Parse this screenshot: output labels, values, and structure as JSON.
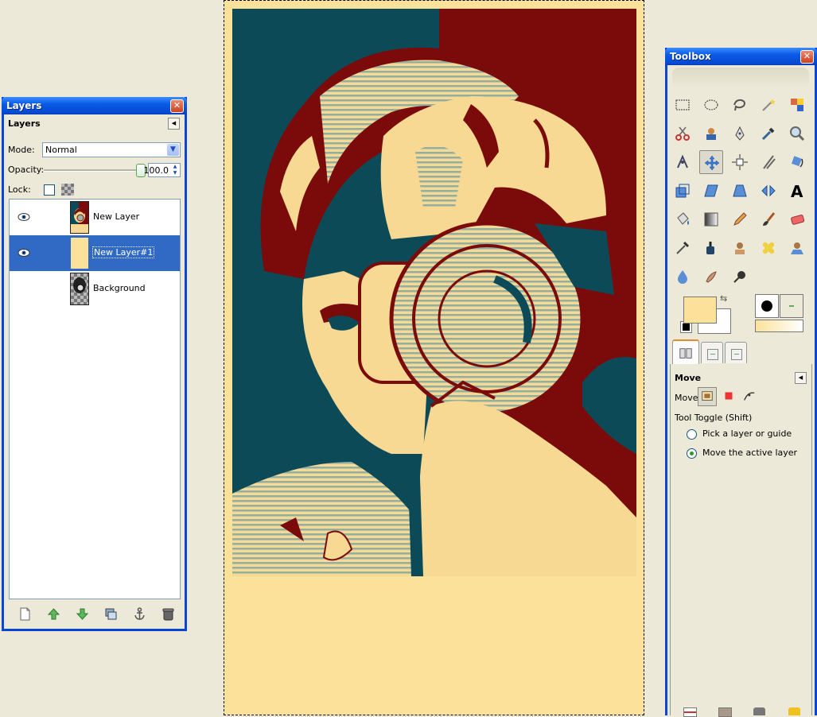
{
  "layers_window": {
    "title": "Layers",
    "panel_title": "Layers",
    "mode_label": "Mode:",
    "mode_value": "Normal",
    "opacity_label": "Opacity:",
    "opacity_value": "100.0",
    "lock_label": "Lock:",
    "layers": [
      {
        "name": "New Layer",
        "visible": true,
        "selected": false
      },
      {
        "name": "New Layer#1",
        "visible": true,
        "selected": true
      },
      {
        "name": "Background",
        "visible": false,
        "selected": false
      }
    ]
  },
  "toolbox": {
    "title": "Toolbox",
    "tools": [
      [
        "rect-select-icon",
        "ellipse-select-icon",
        "free-select-icon",
        "fuzzy-select-icon",
        "select-by-color-icon"
      ],
      [
        "scissors-icon",
        "foreground-select-icon",
        "paths-icon",
        "color-picker-icon",
        "zoom-icon"
      ],
      [
        "measure-icon",
        "move-icon",
        "align-icon",
        "crop-icon",
        "rotate-icon"
      ],
      [
        "scale-icon",
        "shear-icon",
        "perspective-icon",
        "flip-icon",
        "text-icon"
      ],
      [
        "bucket-fill-icon",
        "blend-icon",
        "pencil-icon",
        "paintbrush-icon",
        "eraser-icon"
      ],
      [
        "airbrush-icon",
        "ink-icon",
        "clone-icon",
        "heal-icon",
        "perspective-clone-icon"
      ],
      [
        "blur-icon",
        "smudge-icon",
        "dodge-burn-icon"
      ]
    ],
    "active_tool": "move-icon",
    "fg_color": "#fbe19a",
    "bg_color": "#ffffff",
    "tool_options": {
      "title": "Move",
      "move_label": "Move:",
      "toggle_label": "Tool Toggle  (Shift)",
      "options": [
        "Pick a layer or guide",
        "Move the active layer"
      ],
      "selected_option": 1
    }
  },
  "canvas": {
    "image_bg": "#fbe19a",
    "poster_colors": [
      "#0d4a57",
      "#7b0a0a",
      "#f7d994"
    ]
  }
}
